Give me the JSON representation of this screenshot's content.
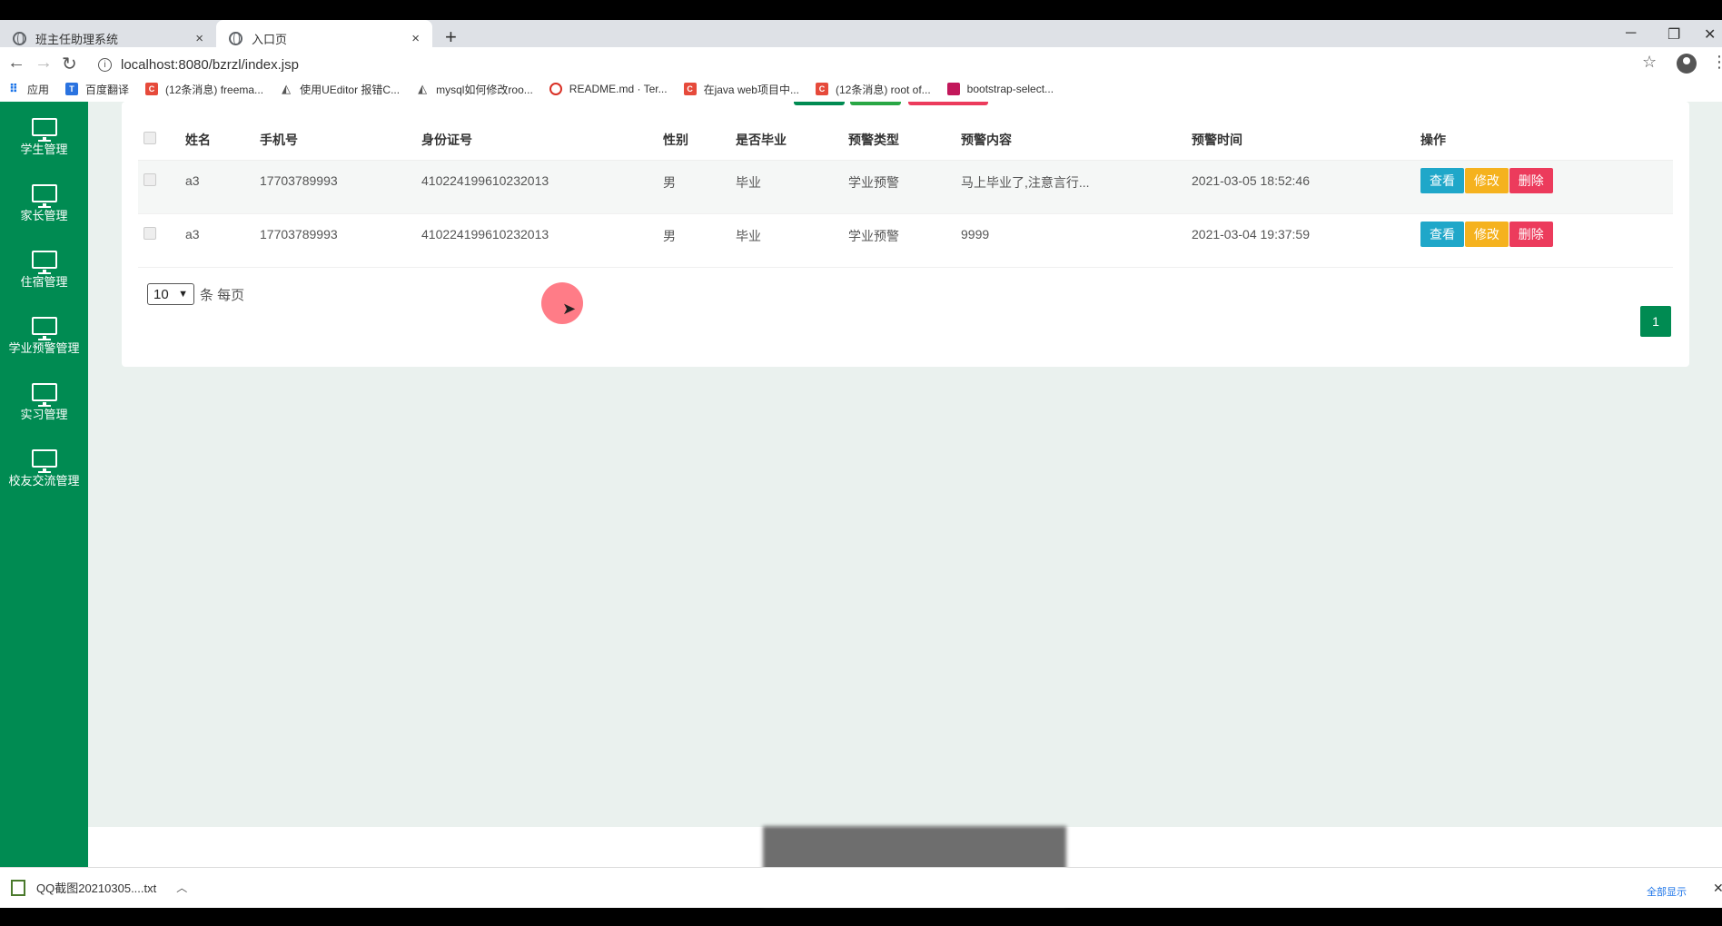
{
  "browser": {
    "tabs": [
      {
        "label": "班主任助理系统",
        "close": "×"
      },
      {
        "label": "入口页",
        "close": "×"
      }
    ],
    "new_tab": "+",
    "window_controls": [
      "─",
      "❐",
      "✕"
    ],
    "url": "localhost:8080/bzrzl/index.jsp",
    "bookmarks": [
      {
        "icon": "grid",
        "label": "应用"
      },
      {
        "icon": "blue",
        "label": "百度翻译"
      },
      {
        "icon": "red",
        "label": "(12条消息) freema..."
      },
      {
        "icon": "tri",
        "label": "使用UEditor 报错C..."
      },
      {
        "icon": "tri",
        "label": "mysql如何修改roo..."
      },
      {
        "icon": "redc",
        "label": "README.md · Ter..."
      },
      {
        "icon": "red",
        "label": "在java web项目中..."
      },
      {
        "icon": "red",
        "label": "(12条消息) root of..."
      },
      {
        "icon": "pink",
        "label": "bootstrap-select..."
      }
    ]
  },
  "sidebar": {
    "items": [
      {
        "label": "学生管理"
      },
      {
        "label": "家长管理"
      },
      {
        "label": "住宿管理"
      },
      {
        "label": "学业预警管理"
      },
      {
        "label": "实习管理"
      },
      {
        "label": "校友交流管理"
      }
    ]
  },
  "table": {
    "headers": [
      "姓名",
      "手机号",
      "身份证号",
      "性别",
      "是否毕业",
      "预警类型",
      "预警内容",
      "预警时间",
      "操作"
    ],
    "rows": [
      {
        "name": "a3",
        "phone": "17703789993",
        "id_card": "410224199610232013",
        "gender": "男",
        "graduated": "毕业",
        "warn_type": "学业预警",
        "warn_content": "马上毕业了,注意言行...",
        "warn_time": "2021-03-05 18:52:46"
      },
      {
        "name": "a3",
        "phone": "17703789993",
        "id_card": "410224199610232013",
        "gender": "男",
        "graduated": "毕业",
        "warn_type": "学业预警",
        "warn_content": "9999",
        "warn_time": "2021-03-04 19:37:59"
      }
    ],
    "actions": {
      "view": "查看",
      "edit": "修改",
      "delete": "删除"
    }
  },
  "pagination": {
    "page_size": "10",
    "page_size_suffix": "条 每页",
    "current_page": "1"
  },
  "downloads": {
    "file": "QQ截图20210305....txt",
    "show_all": "全部显示"
  },
  "colors": {
    "sidebar": "#008b52",
    "view_button": "#1fa7c9",
    "edit_button": "#f5b21e",
    "delete_button": "#ec3b5c"
  }
}
